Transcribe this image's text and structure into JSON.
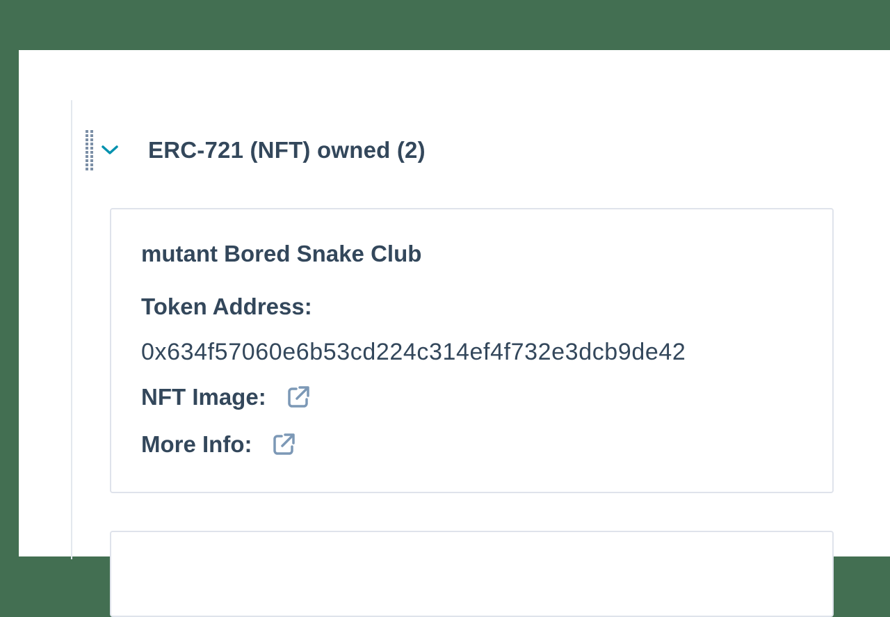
{
  "section": {
    "title": "ERC-721 (NFT) owned (2)",
    "expanded": true
  },
  "nfts": [
    {
      "name": "mutant Bored Snake Club",
      "token_address_label": "Token Address:",
      "token_address": "0x634f57060e6b53cd224c314ef4f732e3dcb9de42",
      "image_label": "NFT Image:",
      "info_label": "More Info:"
    }
  ],
  "icons": {
    "drag": "drag-handle-icon",
    "chevron": "chevron-down-icon",
    "external": "external-link-icon"
  },
  "colors": {
    "background": "#436f52",
    "text": "#33475b",
    "accent": "#0091ae",
    "icon": "#7c98b6"
  }
}
